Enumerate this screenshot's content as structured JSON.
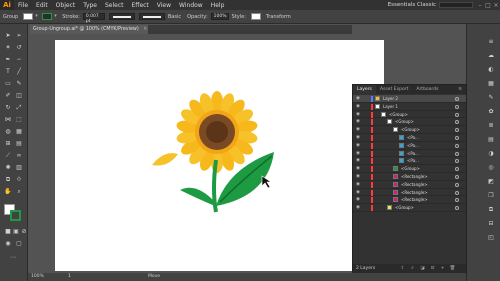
{
  "menu": {
    "logo": "Ai",
    "items": [
      "File",
      "Edit",
      "Object",
      "Type",
      "Select",
      "Effect",
      "View",
      "Window",
      "Help"
    ],
    "workspace": "Essentials Classic"
  },
  "control": {
    "selection_label": "Group",
    "stroke_label": "Stroke:",
    "stroke_value": "0.007 pt",
    "brush_label": "Basic",
    "opacity_label": "Opacity:",
    "opacity_value": "100%",
    "style_label": "Style:",
    "transform_label": "Transform"
  },
  "document": {
    "tab_title": "Group-Ungroup.ai* @ 100% (CMYK/Preview)",
    "close": "×"
  },
  "layers_panel": {
    "tabs": [
      "Layers",
      "Asset Export",
      "Artboards"
    ],
    "rows": [
      {
        "name": "Layer 2",
        "color": "#5b7cff"
      },
      {
        "name": "Layer 1",
        "color": "#ff3b3b"
      },
      {
        "name": "<Group>",
        "color": "#ff3b3b"
      },
      {
        "name": "<Group>",
        "color": "#ff3b3b"
      },
      {
        "name": "<Group>",
        "color": "#ff3b3b"
      },
      {
        "name": "<Pa...",
        "color": "#ff3b3b"
      },
      {
        "name": "<Pa...",
        "color": "#ff3b3b"
      },
      {
        "name": "<Pa...",
        "color": "#ff3b3b"
      },
      {
        "name": "<Pa...",
        "color": "#ff3b3b"
      },
      {
        "name": "<Group>",
        "color": "#ff3b3b"
      },
      {
        "name": "<Rectangle>",
        "color": "#ff3b3b"
      },
      {
        "name": "<Rectangle>",
        "color": "#ff3b3b"
      },
      {
        "name": "<Rectangle>",
        "color": "#ff3b3b"
      },
      {
        "name": "<Rectangle>",
        "color": "#ff3b3b"
      },
      {
        "name": "<Group>",
        "color": "#ff3b3b"
      }
    ],
    "footer": "2 Layers"
  },
  "status": {
    "zoom": "100%",
    "page": "1",
    "tool": "Move"
  },
  "colors": {
    "petals": "#f7b81c",
    "center": "#6b3d1e",
    "leaf": "#1e9a43"
  }
}
